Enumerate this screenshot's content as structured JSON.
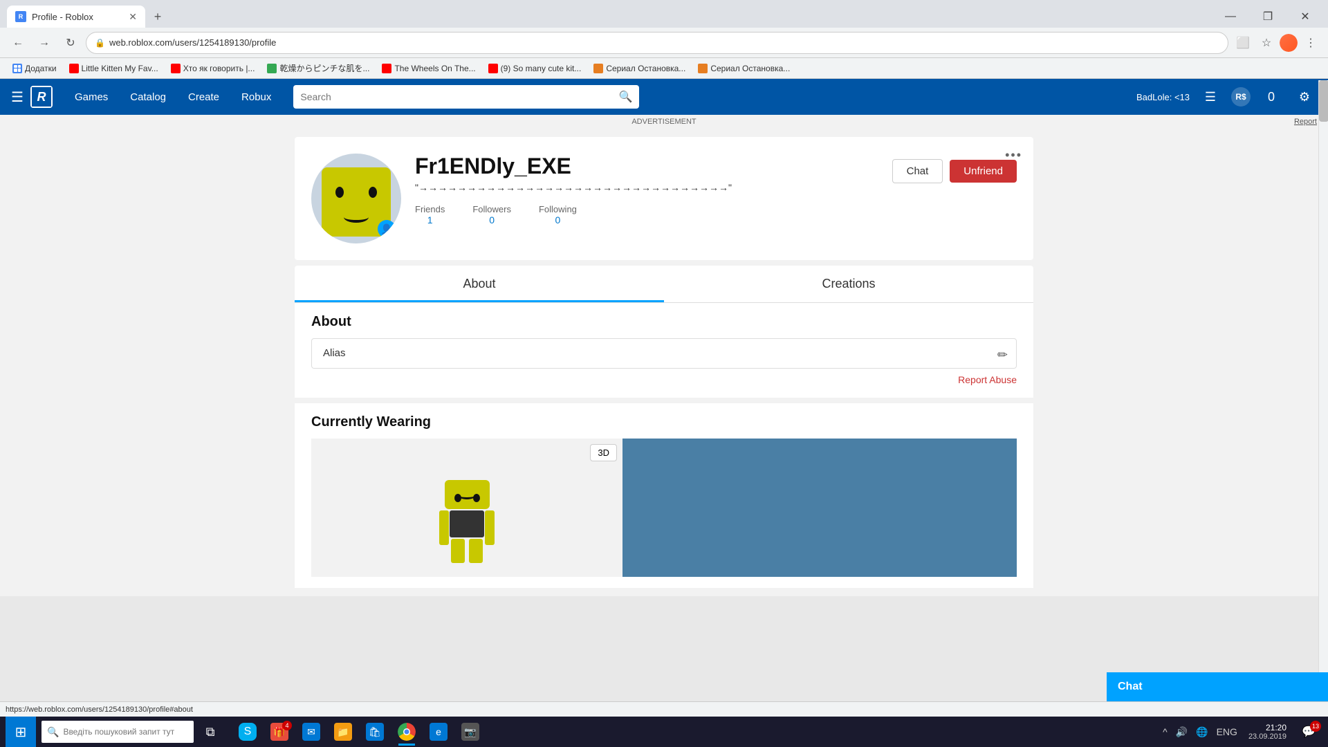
{
  "browser": {
    "tab_title": "Profile - Roblox",
    "tab_favicon": "🟦",
    "url": "web.roblox.com/users/1254189130/profile",
    "add_tab_label": "+",
    "window_minimize": "—",
    "window_maximize": "❐",
    "window_close": "✕",
    "nav_back": "←",
    "nav_forward": "→",
    "nav_refresh": "↻",
    "search_placeholder": "Search"
  },
  "bookmarks": [
    {
      "label": "Додатки",
      "icon": "grid",
      "color": "#4285f4"
    },
    {
      "label": "Little Kitten My Fav...",
      "icon": "yt",
      "color": "#ff0000"
    },
    {
      "label": "Хто як говорить |...",
      "icon": "yt",
      "color": "#ff0000"
    },
    {
      "label": "乾燥からピンチな肌を...",
      "icon": "globe",
      "color": "#34a853"
    },
    {
      "label": "The Wheels On The...",
      "icon": "yt",
      "color": "#ff0000"
    },
    {
      "label": "(9) So many cute kit...",
      "icon": "yt",
      "color": "#ff0000"
    },
    {
      "label": "Сериал Остановка...",
      "icon": "fox",
      "color": "#e67e22"
    },
    {
      "label": "Сериал Остановка...",
      "icon": "fox",
      "color": "#e67e22"
    }
  ],
  "roblox_nav": {
    "games_label": "Games",
    "catalog_label": "Catalog",
    "create_label": "Create",
    "robux_label": "Robux",
    "search_placeholder": "Search",
    "username": "BadLole: <13",
    "robux_icon_label": "RS",
    "notifications_count": "0"
  },
  "ad_bar": {
    "label": "ADVERTISEMENT",
    "report_label": "Report"
  },
  "profile": {
    "username": "Fr1ENDly_EXE",
    "status": "\"→→→→→→→→→→→→→→→→→→→→→→→→→→→→→→→→\"",
    "friends_label": "Friends",
    "friends_count": "1",
    "followers_label": "Followers",
    "followers_count": "0",
    "following_label": "Following",
    "following_count": "0",
    "chat_button": "Chat",
    "unfriend_button": "Unfriend",
    "dots_label": "•••"
  },
  "tabs": {
    "about_label": "About",
    "creations_label": "Creations"
  },
  "about": {
    "title": "About",
    "alias_label": "Alias",
    "report_abuse_label": "Report Abuse"
  },
  "wearing": {
    "title": "Currently Wearing",
    "btn_3d": "3D"
  },
  "chat_widget": {
    "label": "Chat"
  },
  "status_bar": {
    "url": "https://web.roblox.com/users/1254189130/profile#about"
  },
  "taskbar": {
    "search_placeholder": "Введіть пошуковий запит тут",
    "clock_time": "21:20",
    "clock_date": "23.09.2019",
    "notification_count": "13",
    "lang": "ENG"
  }
}
